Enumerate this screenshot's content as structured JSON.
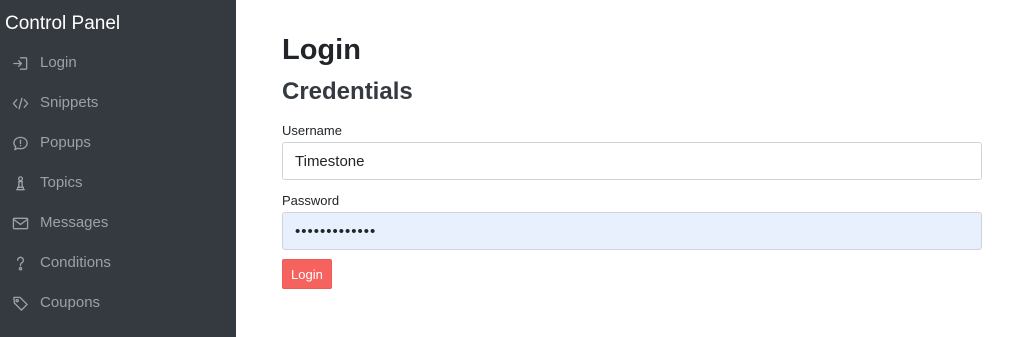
{
  "sidebar": {
    "brand": "Control Panel",
    "items": [
      {
        "label": "Login",
        "icon": "sign-in-icon"
      },
      {
        "label": "Snippets",
        "icon": "code-icon"
      },
      {
        "label": "Popups",
        "icon": "comment-alert-icon"
      },
      {
        "label": "Topics",
        "icon": "chess-pawn-icon"
      },
      {
        "label": "Messages",
        "icon": "envelope-icon"
      },
      {
        "label": "Conditions",
        "icon": "question-icon"
      },
      {
        "label": "Coupons",
        "icon": "tag-icon"
      }
    ]
  },
  "main": {
    "title": "Login",
    "section": "Credentials",
    "form": {
      "username_label": "Username",
      "username_value": "Timestone",
      "password_label": "Password",
      "password_value": "•••••••••••••",
      "submit_label": "Login"
    }
  },
  "colors": {
    "sidebar_bg": "#343a40",
    "nav_text": "#9aa1a8",
    "accent_button": "#f6625e",
    "autofill_bg": "#e8f0fe"
  }
}
